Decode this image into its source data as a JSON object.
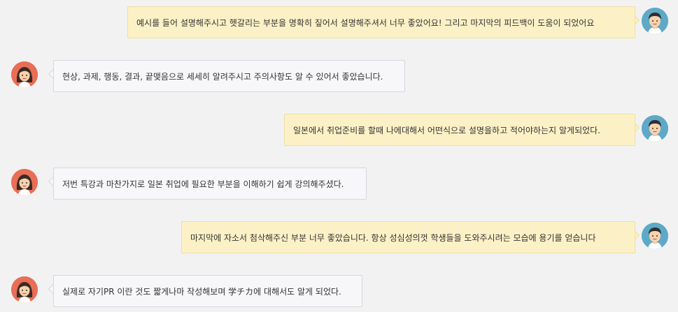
{
  "messages": [
    {
      "side": "right",
      "avatar_icon": "male-avatar-icon",
      "text": "예시를 들어 설명해주시고 헷갈리는 부분을 명확히 짚어서 설명해주셔서 너무 좋았어요! 그리고 마지막의 피드백이 도움이 되었어요"
    },
    {
      "side": "left",
      "avatar_icon": "female-avatar-icon",
      "text": "현상, 과제, 행동, 결과, 끝맺음으로 세세히 알려주시고 주의사항도 알 수 있어서 좋았습니다."
    },
    {
      "side": "right",
      "avatar_icon": "male-avatar-icon",
      "text": "일본에서 취업준비를 할때 나에대해서 어떤식으로 설명을하고 적어야하는지 알게되었다."
    },
    {
      "side": "left",
      "avatar_icon": "female-avatar-icon",
      "text": "저번 특강과 마찬가지로 일본 취업에 필요한 부분을 이해하기 쉽게 강의해주셨다."
    },
    {
      "side": "right",
      "avatar_icon": "male-avatar-icon",
      "text": "마지막에 자소서 첨삭해주신 부분 너무 좋았습니다. 항상 성심성의껏 학생들을 도와주시려는 모습에 용기를 얻습니다"
    },
    {
      "side": "left",
      "avatar_icon": "female-avatar-icon",
      "text": "실제로 자기PR 이란 것도 짧게나마 작성해보며 学チカ에 대해서도 알게 되었다."
    }
  ],
  "colors": {
    "page_bg": "#f2f2f2",
    "right_bubble_bg": "#fcf1c6",
    "left_bubble_bg": "#f7f7fa",
    "male_avatar_bg": "#5fa9c8",
    "female_avatar_bg": "#e86e56"
  }
}
